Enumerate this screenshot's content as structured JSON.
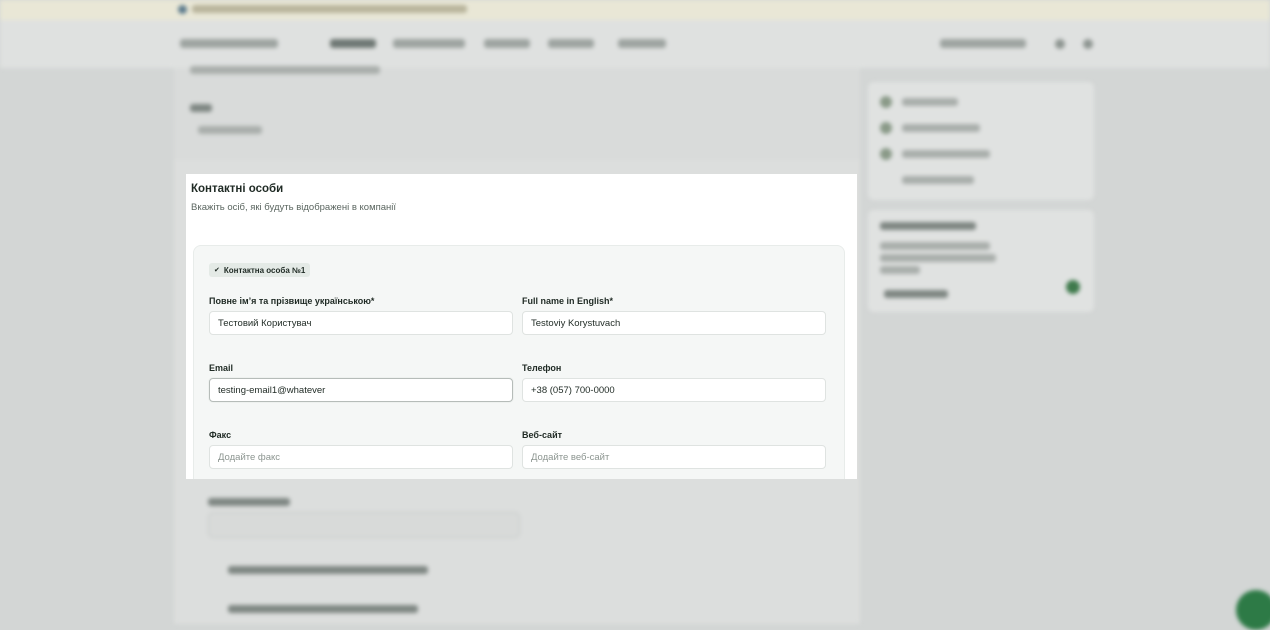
{
  "section": {
    "title": "Контактні особи",
    "subtitle": "Вкажіть осіб, які будуть відображені в компанії"
  },
  "contact": {
    "chip_label": "Контактна особа №1",
    "fields": {
      "name_uk": {
        "label": "Повне ім’я та прізвище українською*",
        "value": "Тестовий Користувач",
        "placeholder": ""
      },
      "name_en": {
        "label": "Full name in English*",
        "value": "Testoviy Korystuvach",
        "placeholder": ""
      },
      "email": {
        "label": "Email",
        "value": "testing-email1@whatever",
        "placeholder": ""
      },
      "phone": {
        "label": "Телефон",
        "value": "+38 (057) 700-0000",
        "placeholder": ""
      },
      "fax": {
        "label": "Факс",
        "value": "",
        "placeholder": "Додайте факс"
      },
      "website": {
        "label": "Веб-сайт",
        "value": "",
        "placeholder": "Додайте веб-сайт"
      }
    }
  },
  "icons": {
    "chip_check": "check-icon"
  },
  "colors": {
    "accent": "#2d7a46",
    "overlay": "#d3d6d5",
    "card_bg": "#ffffff",
    "inner_bg": "#f5f7f6"
  }
}
